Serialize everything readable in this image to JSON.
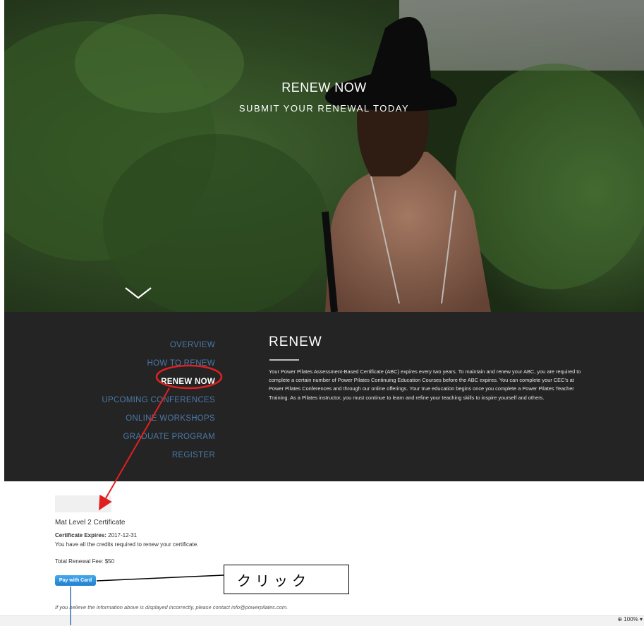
{
  "hero": {
    "title": "RENEW NOW",
    "subtitle": "SUBMIT YOUR RENEWAL TODAY"
  },
  "nav": {
    "items": [
      {
        "label": "OVERVIEW",
        "active": false
      },
      {
        "label": "HOW TO RENEW",
        "active": false
      },
      {
        "label": "RENEW NOW",
        "active": true
      },
      {
        "label": "UPCOMING CONFERENCES",
        "active": false
      },
      {
        "label": "ONLINE WORKSHOPS",
        "active": false
      },
      {
        "label": "GRADUATE PROGRAM",
        "active": false
      },
      {
        "label": "REGISTER",
        "active": false
      }
    ]
  },
  "renew": {
    "heading": "RENEW",
    "body": "Your Power Pilates Assessment-Based Certificate (ABC) expires every two years. To maintain and renew your ABC, you are required to complete a certain number of Power Pilates Continuing Education Courses before the ABC expires. You can complete your CEC's at Power Pilates Conferences and through our online offerings. Your true education begins once you complete a Power Pilates Teacher Training. As a Pilates instructor, you must continue to learn and refine your teaching skills to inspire yourself and others."
  },
  "certificate": {
    "name": "Mat Level 2 Certificate",
    "expires_label": "Certificate Expires:",
    "expires_value": "2017-12-31",
    "credits_text": "You have all the credits required to renew your certificate.",
    "fee_text": "Total Renewal Fee: $50",
    "pay_label": "Pay with Card",
    "notice": "If you believe the information above is displayed incorrectly, please contact info@powerpilates.com."
  },
  "annotation": {
    "callout_text": "クリック"
  },
  "status": {
    "zoom": "100%"
  },
  "colors": {
    "dark_bg": "#242424",
    "nav_link": "#4a78a6",
    "button": "#1f7fcf",
    "annotation_red": "#e02020",
    "annotation_blue": "#3a6fb5"
  }
}
